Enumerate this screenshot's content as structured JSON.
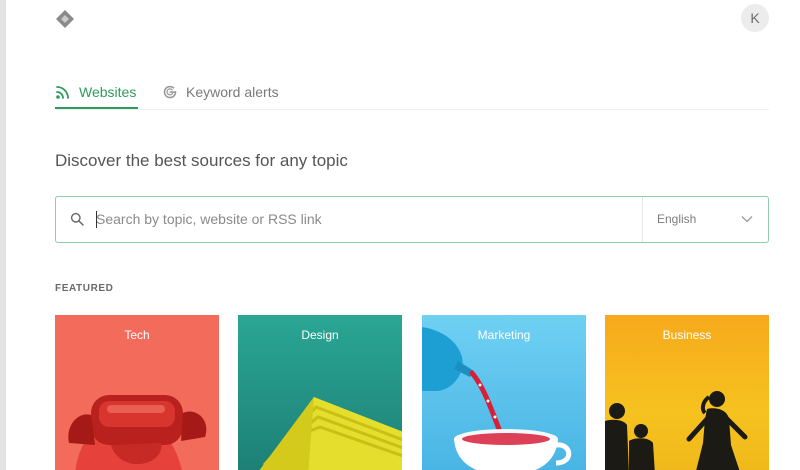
{
  "header": {
    "logo_icon": "feedly-logo-icon",
    "avatar_initial": "K"
  },
  "tabs": [
    {
      "label": "Websites",
      "icon": "rss-icon",
      "active": true
    },
    {
      "label": "Keyword alerts",
      "icon": "google-alerts-icon",
      "active": false
    }
  ],
  "main": {
    "headline": "Discover the best sources for any topic",
    "search": {
      "placeholder": "Search by topic, website or RSS link",
      "value": "",
      "language": "English"
    },
    "featured_label": "FEATURED",
    "cards": [
      {
        "title": "Tech"
      },
      {
        "title": "Design"
      },
      {
        "title": "Marketing"
      },
      {
        "title": "Business"
      }
    ]
  },
  "colors": {
    "accent": "#2e9b5e",
    "search_border": "#8fcca7",
    "tech": "#f26b5b",
    "design": "#2a9a8c",
    "marketing": "#5bc2ea",
    "business": "#f4b51f"
  }
}
